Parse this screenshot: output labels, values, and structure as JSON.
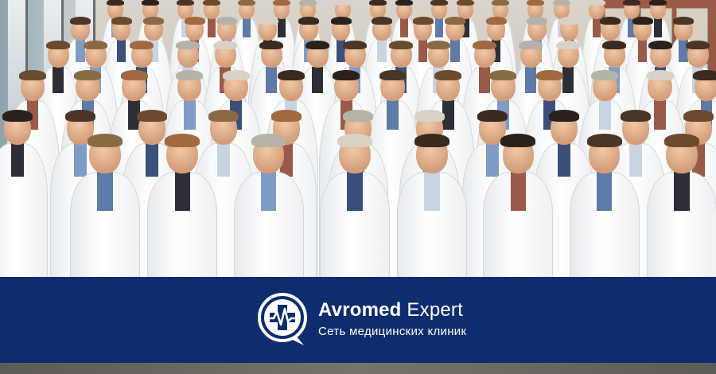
{
  "brand": {
    "name_bold": "Avromed",
    "name_light": "Expert",
    "tagline": "Сеть медицинских клиник",
    "logo_icon": "heartbeat-cross-icon",
    "banner_color": "#0e2d6e"
  },
  "photo": {
    "subject": "group-photo-of-doctors-in-white-coats"
  }
}
